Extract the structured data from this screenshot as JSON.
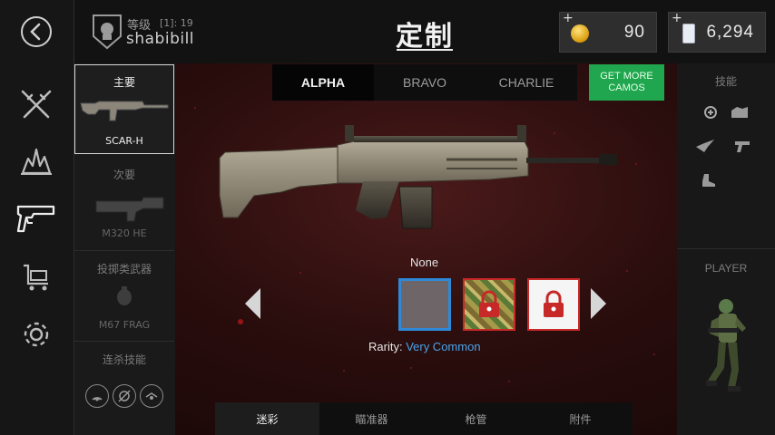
{
  "header": {
    "rank_label": "等级",
    "rank_value": "[1]: 19",
    "username": "shabibill",
    "page_title": "定制"
  },
  "currency": {
    "coins": {
      "plus": "+",
      "value": "90",
      "icon": "gold-coin-icon"
    },
    "credits": {
      "plus": "+",
      "value": "6,294",
      "icon": "credit-card-icon"
    }
  },
  "nav": [
    {
      "icon": "back-arrow-icon"
    },
    {
      "icon": "crossed-rifles-icon"
    },
    {
      "icon": "explosion-icon"
    },
    {
      "icon": "pistol-icon",
      "active": true
    },
    {
      "icon": "cart-icon"
    },
    {
      "icon": "gear-icon"
    }
  ],
  "loadout": {
    "primary": {
      "title": "主要",
      "weapon": "SCAR-H"
    },
    "secondary": {
      "title": "次要",
      "weapon": "M320 HE"
    },
    "throwable": {
      "title": "投掷类武器",
      "weapon": "M67 FRAG"
    },
    "killstreak": {
      "title": "连杀技能"
    }
  },
  "camo_tabs": [
    "ALPHA",
    "BRAVO",
    "CHARLIE"
  ],
  "active_camo_tab": "ALPHA",
  "get_more_camos": [
    "GET MORE",
    "CAMOS"
  ],
  "camo": {
    "selected_name": "None",
    "rarity_label": "Rarity:",
    "rarity_value": "Very Common"
  },
  "bottom_tabs": [
    "迷彩",
    "瞄准器",
    "枪管",
    "附件"
  ],
  "active_bottom_tab": "迷彩",
  "right_panel": {
    "skills_title": "技能",
    "player_title": "PLAYER"
  },
  "colors": {
    "accent_green": "#1fa64e",
    "selection_blue": "#2e8ad8",
    "locked_red": "#c72828",
    "rarity_blue": "#4aa3e8"
  }
}
